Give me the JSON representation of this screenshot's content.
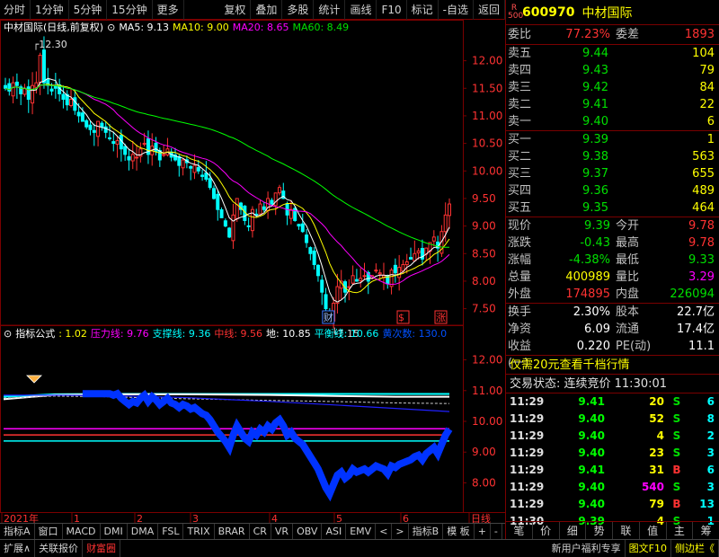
{
  "toolbar": {
    "left": [
      "分时",
      "1分钟",
      "5分钟",
      "15分钟",
      "更多"
    ],
    "right": [
      "复权",
      "叠加",
      "多股",
      "统计",
      "画线",
      "F10",
      "标记",
      "-自选",
      "返回"
    ]
  },
  "ma_legend": {
    "title": "中材国际(日线,前复权)",
    "ma5": "MA5: 9.13",
    "ma10": "MA10: 9.00",
    "ma20": "MA20: 8.65",
    "ma60": "MA60: 8.49"
  },
  "ind_legend": {
    "name": "指标公式",
    "v1": ": 1.02",
    "v2": "压力线: 9.76",
    "v3": "支撑线: 9.36",
    "v4": "中线: 9.56",
    "v5": "地: 10.85",
    "v6": "平衡线: 10.66",
    "v7": "黄次数: 130.0"
  },
  "colors": {
    "up": "#ff3232",
    "down": "#00ffff",
    "ma5": "#ffffff",
    "ma10": "#ffff00",
    "ma20": "#ff00ff",
    "ma60": "#00ff00",
    "blue": "#0033ff"
  },
  "chart_data": [
    {
      "type": "candlestick",
      "title": "中材国际(日线,前复权)",
      "ylim": [
        7.2,
        12.45
      ],
      "yticks": [
        12.0,
        11.5,
        11.0,
        10.5,
        10.0,
        9.5,
        9.0,
        8.5,
        8.0,
        7.5
      ],
      "x_labels": [
        "2021年",
        "1",
        "2",
        "3",
        "4",
        "5",
        "6",
        "日线"
      ],
      "high_label": "12.30",
      "low_label": "7.15",
      "markers": [
        "财",
        "$",
        "涨"
      ],
      "closes": [
        11.5,
        11.45,
        11.6,
        11.55,
        11.4,
        11.5,
        11.3,
        11.55,
        11.6,
        12.1,
        11.6,
        11.55,
        11.45,
        11.5,
        11.4,
        11.3,
        11.2,
        11.3,
        11.1,
        11.0,
        10.9,
        10.8,
        10.75,
        10.7,
        10.9,
        10.8,
        10.7,
        10.6,
        10.5,
        10.55,
        10.4,
        10.3,
        10.2,
        10.3,
        10.25,
        10.4,
        10.5,
        10.3,
        10.45,
        10.35,
        10.2,
        10.3,
        10.4,
        10.25,
        10.2,
        10.1,
        10.2,
        10.15,
        10.05,
        10.1,
        10.0,
        9.9,
        9.85,
        9.7,
        9.5,
        9.3,
        9.15,
        9.0,
        8.8,
        9.2,
        9.5,
        9.3,
        9.1,
        9.0,
        9.3,
        9.2,
        9.4,
        9.3,
        9.5,
        9.4,
        9.6,
        9.7,
        9.5,
        9.2,
        9.3,
        9.1,
        9.0,
        8.9,
        8.7,
        8.5,
        8.3,
        8.1,
        7.8,
        7.5,
        7.3,
        7.6,
        7.9,
        8.0,
        7.8,
        7.9,
        8.1,
        8.0,
        8.05,
        8.1,
        8.0,
        8.1,
        8.2,
        8.15,
        8.1,
        7.95,
        8.2,
        8.15,
        8.25,
        8.3,
        8.35,
        8.4,
        8.5,
        8.55,
        8.4,
        8.6,
        8.7,
        8.8,
        8.6,
        8.9,
        9.2,
        9.4
      ],
      "ma5": 9.13,
      "ma10": 9.0,
      "ma20": 8.65,
      "ma60": 8.49
    },
    {
      "type": "line",
      "title": "指标公式",
      "ylim": [
        7.05,
        12.6
      ],
      "yticks": [
        12.0,
        11.0,
        10.0,
        9.0,
        8.0
      ],
      "series": [
        {
          "name": "压力线",
          "values": [
            9.76
          ]
        },
        {
          "name": "支撑线",
          "values": [
            9.36
          ]
        },
        {
          "name": "中线",
          "values": [
            9.56
          ]
        },
        {
          "name": "地",
          "values": [
            10.85
          ]
        },
        {
          "name": "平衡线",
          "values": [
            10.66
          ]
        }
      ]
    }
  ],
  "header": {
    "badge_top": "R",
    "badge_bottom": "500",
    "code": "600970",
    "name": "中材国际"
  },
  "wei": {
    "label1": "委比",
    "value1": "77.23%",
    "label2": "委差",
    "value2": "1893"
  },
  "sells": [
    {
      "label": "卖五",
      "price": "9.44",
      "vol": "104"
    },
    {
      "label": "卖四",
      "price": "9.43",
      "vol": "79"
    },
    {
      "label": "卖三",
      "price": "9.42",
      "vol": "84"
    },
    {
      "label": "卖二",
      "price": "9.41",
      "vol": "22"
    },
    {
      "label": "卖一",
      "price": "9.40",
      "vol": "6"
    }
  ],
  "buys": [
    {
      "label": "买一",
      "price": "9.39",
      "vol": "1"
    },
    {
      "label": "买二",
      "price": "9.38",
      "vol": "563"
    },
    {
      "label": "买三",
      "price": "9.37",
      "vol": "655"
    },
    {
      "label": "买四",
      "price": "9.36",
      "vol": "489"
    },
    {
      "label": "买五",
      "price": "9.35",
      "vol": "464"
    }
  ],
  "quote": [
    {
      "l1": "现价",
      "v1": "9.39",
      "l2": "今开",
      "v2": "9.78"
    },
    {
      "l1": "涨跌",
      "v1": "-0.43",
      "l2": "最高",
      "v2": "9.78"
    },
    {
      "l1": "涨幅",
      "v1": "-4.38%",
      "l2": "最低",
      "v2": "9.33"
    },
    {
      "l1": "总量",
      "v1": "400989",
      "l2": "量比",
      "v2": "3.29"
    },
    {
      "l1": "外盘",
      "v1": "174895",
      "l2": "内盘",
      "v2": "226094"
    }
  ],
  "fund": [
    {
      "l1": "换手",
      "v1": "2.30%",
      "l2": "股本",
      "v2": "22.7亿"
    },
    {
      "l1": "净资",
      "v1": "6.09",
      "l2": "流通",
      "v2": "17.4亿"
    },
    {
      "l1": "收益(一)",
      "v1": "0.220",
      "l2": "PE(动)",
      "v2": "11.1"
    }
  ],
  "promo": "仅需20元查看千档行情",
  "trade_status": "交易状态: 连续竞价 11:30:01",
  "ticks": [
    {
      "time": "11:29",
      "price": "9.41",
      "vol": "20",
      "bs": "S",
      "n": "6"
    },
    {
      "time": "11:29",
      "price": "9.40",
      "vol": "52",
      "bs": "S",
      "n": "8"
    },
    {
      "time": "11:29",
      "price": "9.40",
      "vol": "4",
      "bs": "S",
      "n": "2"
    },
    {
      "time": "11:29",
      "price": "9.40",
      "vol": "23",
      "bs": "S",
      "n": "3"
    },
    {
      "time": "11:29",
      "price": "9.41",
      "vol": "31",
      "bs": "B",
      "n": "6"
    },
    {
      "time": "11:29",
      "price": "9.40",
      "vol": "540",
      "bs": "S",
      "n": "3"
    },
    {
      "time": "11:29",
      "price": "9.40",
      "vol": "79",
      "bs": "B",
      "n": "13"
    },
    {
      "time": "11:30",
      "price": "9.39",
      "vol": "4",
      "bs": "S",
      "n": "1"
    }
  ],
  "panel_bar": [
    "笔",
    "价",
    "细",
    "势",
    "联",
    "值",
    "主",
    "筹"
  ],
  "tabs1": [
    "指标A",
    "窗口",
    "MACD",
    "DMI",
    "DMA",
    "FSL",
    "TRIX",
    "BRAR",
    "CR",
    "VR",
    "OBV",
    "ASI",
    "EMV",
    "<",
    ">",
    "指标B",
    "模 板",
    "+",
    "-"
  ],
  "tabs2": [
    "扩展∧",
    "关联报价",
    "财富圈",
    "新用户福利专享",
    "图文F10",
    "侧边栏《"
  ]
}
